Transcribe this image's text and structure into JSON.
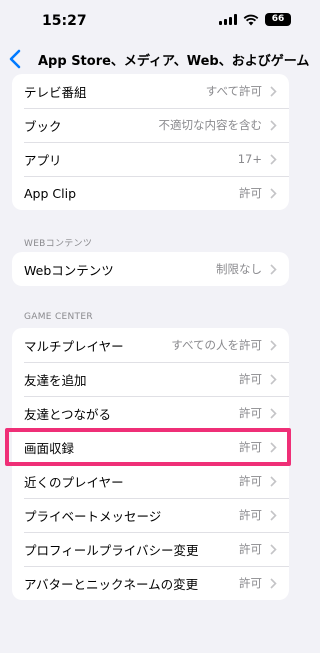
{
  "status": {
    "time": "15:27",
    "battery": "66"
  },
  "nav": {
    "title": "App Store、メディア、Web、およびゲーム"
  },
  "section1": {
    "rows": [
      {
        "label": "テレビ番組",
        "value": "すべて許可"
      },
      {
        "label": "ブック",
        "value": "不適切な内容を含む"
      },
      {
        "label": "アプリ",
        "value": "17+"
      },
      {
        "label": "App Clip",
        "value": "許可"
      }
    ]
  },
  "web_section": {
    "header": "WEBコンテンツ",
    "rows": [
      {
        "label": "Webコンテンツ",
        "value": "制限なし"
      }
    ]
  },
  "game_section": {
    "header": "GAME CENTER",
    "rows": [
      {
        "label": "マルチプレイヤー",
        "value": "すべての人を許可"
      },
      {
        "label": "友達を追加",
        "value": "許可"
      },
      {
        "label": "友達とつながる",
        "value": "許可"
      },
      {
        "label": "画面収録",
        "value": "許可"
      },
      {
        "label": "近くのプレイヤー",
        "value": "許可"
      },
      {
        "label": "プライベートメッセージ",
        "value": "許可"
      },
      {
        "label": "プロフィールプライバシー変更",
        "value": "許可"
      },
      {
        "label": "アバターとニックネームの変更",
        "value": "許可"
      }
    ]
  },
  "colors": {
    "accent": "#007aff",
    "highlight": "#ef2f77",
    "background": "#f2f2f7"
  }
}
